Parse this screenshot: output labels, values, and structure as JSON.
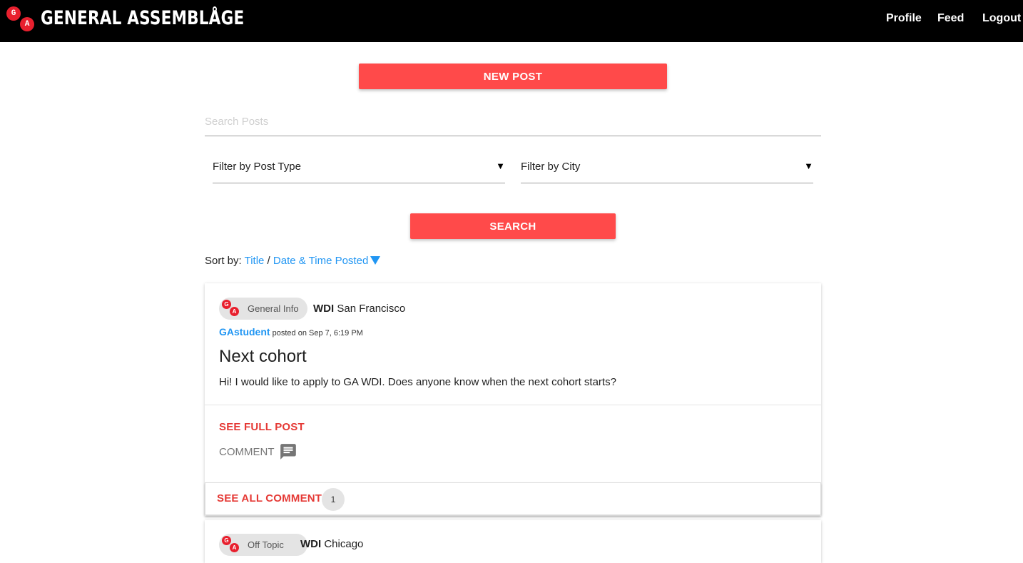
{
  "header": {
    "logo_letters": [
      "G",
      "A"
    ],
    "brand": "GENERAL ASSEMBLÅGE",
    "nav": {
      "profile": "Profile",
      "feed": "Feed",
      "logout": "Logout"
    }
  },
  "actions": {
    "new_post": "NEW POST",
    "search_button": "SEARCH"
  },
  "search": {
    "placeholder": "Search Posts",
    "value": ""
  },
  "filters": {
    "post_type": {
      "label": "Filter by Post Type"
    },
    "city": {
      "label": "Filter by City"
    }
  },
  "sort": {
    "prefix": "Sort by:",
    "title_option": "Title",
    "separator": "/",
    "date_option": "Date & Time Posted",
    "direction": "descending"
  },
  "posts": [
    {
      "type": "General Info",
      "program": "WDI",
      "city": "San Francisco",
      "author": "GAstudent",
      "posted_text": "posted on Sep 7, 6:19 PM",
      "title": "Next cohort",
      "body": "Hi! I would like to apply to GA WDI. Does anyone know when the next cohort starts?",
      "see_full": "SEE FULL POST",
      "comment": "COMMENT",
      "see_all_comments": "SEE ALL COMMENTS",
      "comment_count": "1"
    },
    {
      "type": "Off Topic",
      "program": "WDI",
      "city": "Chicago"
    }
  ],
  "colors": {
    "accent_red": "#ff4a4a",
    "link_blue": "#2196f3",
    "topbar": "#000000"
  }
}
